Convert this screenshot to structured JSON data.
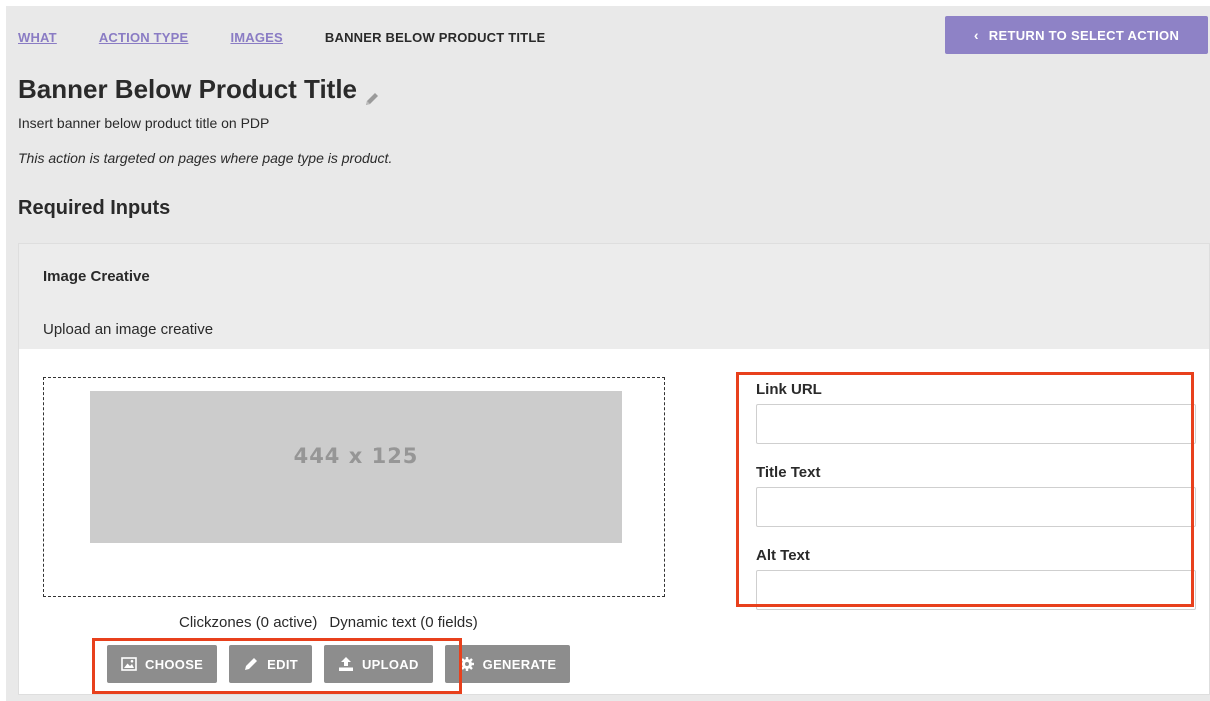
{
  "breadcrumb": [
    "WHAT",
    "ACTION TYPE",
    "IMAGES",
    "BANNER BELOW PRODUCT TITLE"
  ],
  "header": {
    "return_label": "RETURN TO SELECT ACTION",
    "title": "Banner Below Product Title",
    "subtitle": "Insert banner below product title on PDP",
    "targeting": "This action is targeted on pages where page type is product."
  },
  "required_heading": "Required Inputs",
  "creative": {
    "title": "Image Creative",
    "description": "Upload an image creative",
    "placeholder_size": "444 x 125",
    "clickzones": "Clickzones (0 active)",
    "dynamic_text": "Dynamic text (0 fields)"
  },
  "buttons": {
    "choose": "CHOOSE",
    "edit": "EDIT",
    "upload": "UPLOAD",
    "generate": "GENERATE"
  },
  "fields": {
    "link_url_label": "Link URL",
    "link_url_value": "",
    "title_text_label": "Title Text",
    "title_text_value": "",
    "alt_text_label": "Alt Text",
    "alt_text_value": ""
  },
  "colors": {
    "accent": "#8e82c6",
    "link": "#8a7cc4",
    "action_button": "#8d8d8d",
    "highlight": "#e8401c"
  }
}
